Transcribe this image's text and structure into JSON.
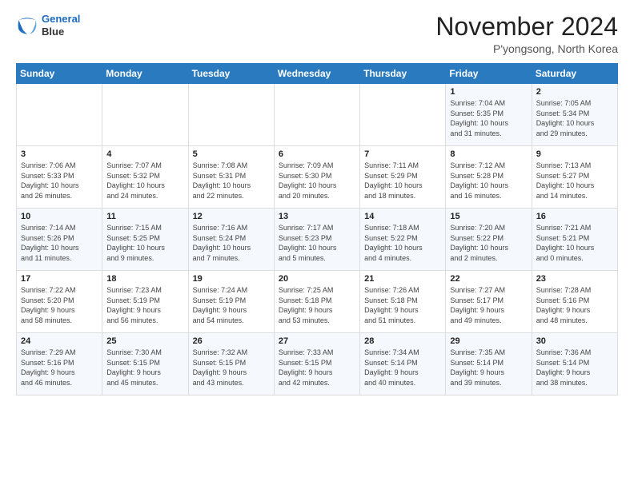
{
  "header": {
    "logo_line1": "General",
    "logo_line2": "Blue",
    "month_title": "November 2024",
    "location": "P'yongsong, North Korea"
  },
  "weekdays": [
    "Sunday",
    "Monday",
    "Tuesday",
    "Wednesday",
    "Thursday",
    "Friday",
    "Saturday"
  ],
  "weeks": [
    [
      {
        "day": "",
        "info": ""
      },
      {
        "day": "",
        "info": ""
      },
      {
        "day": "",
        "info": ""
      },
      {
        "day": "",
        "info": ""
      },
      {
        "day": "",
        "info": ""
      },
      {
        "day": "1",
        "info": "Sunrise: 7:04 AM\nSunset: 5:35 PM\nDaylight: 10 hours\nand 31 minutes."
      },
      {
        "day": "2",
        "info": "Sunrise: 7:05 AM\nSunset: 5:34 PM\nDaylight: 10 hours\nand 29 minutes."
      }
    ],
    [
      {
        "day": "3",
        "info": "Sunrise: 7:06 AM\nSunset: 5:33 PM\nDaylight: 10 hours\nand 26 minutes."
      },
      {
        "day": "4",
        "info": "Sunrise: 7:07 AM\nSunset: 5:32 PM\nDaylight: 10 hours\nand 24 minutes."
      },
      {
        "day": "5",
        "info": "Sunrise: 7:08 AM\nSunset: 5:31 PM\nDaylight: 10 hours\nand 22 minutes."
      },
      {
        "day": "6",
        "info": "Sunrise: 7:09 AM\nSunset: 5:30 PM\nDaylight: 10 hours\nand 20 minutes."
      },
      {
        "day": "7",
        "info": "Sunrise: 7:11 AM\nSunset: 5:29 PM\nDaylight: 10 hours\nand 18 minutes."
      },
      {
        "day": "8",
        "info": "Sunrise: 7:12 AM\nSunset: 5:28 PM\nDaylight: 10 hours\nand 16 minutes."
      },
      {
        "day": "9",
        "info": "Sunrise: 7:13 AM\nSunset: 5:27 PM\nDaylight: 10 hours\nand 14 minutes."
      }
    ],
    [
      {
        "day": "10",
        "info": "Sunrise: 7:14 AM\nSunset: 5:26 PM\nDaylight: 10 hours\nand 11 minutes."
      },
      {
        "day": "11",
        "info": "Sunrise: 7:15 AM\nSunset: 5:25 PM\nDaylight: 10 hours\nand 9 minutes."
      },
      {
        "day": "12",
        "info": "Sunrise: 7:16 AM\nSunset: 5:24 PM\nDaylight: 10 hours\nand 7 minutes."
      },
      {
        "day": "13",
        "info": "Sunrise: 7:17 AM\nSunset: 5:23 PM\nDaylight: 10 hours\nand 5 minutes."
      },
      {
        "day": "14",
        "info": "Sunrise: 7:18 AM\nSunset: 5:22 PM\nDaylight: 10 hours\nand 4 minutes."
      },
      {
        "day": "15",
        "info": "Sunrise: 7:20 AM\nSunset: 5:22 PM\nDaylight: 10 hours\nand 2 minutes."
      },
      {
        "day": "16",
        "info": "Sunrise: 7:21 AM\nSunset: 5:21 PM\nDaylight: 10 hours\nand 0 minutes."
      }
    ],
    [
      {
        "day": "17",
        "info": "Sunrise: 7:22 AM\nSunset: 5:20 PM\nDaylight: 9 hours\nand 58 minutes."
      },
      {
        "day": "18",
        "info": "Sunrise: 7:23 AM\nSunset: 5:19 PM\nDaylight: 9 hours\nand 56 minutes."
      },
      {
        "day": "19",
        "info": "Sunrise: 7:24 AM\nSunset: 5:19 PM\nDaylight: 9 hours\nand 54 minutes."
      },
      {
        "day": "20",
        "info": "Sunrise: 7:25 AM\nSunset: 5:18 PM\nDaylight: 9 hours\nand 53 minutes."
      },
      {
        "day": "21",
        "info": "Sunrise: 7:26 AM\nSunset: 5:18 PM\nDaylight: 9 hours\nand 51 minutes."
      },
      {
        "day": "22",
        "info": "Sunrise: 7:27 AM\nSunset: 5:17 PM\nDaylight: 9 hours\nand 49 minutes."
      },
      {
        "day": "23",
        "info": "Sunrise: 7:28 AM\nSunset: 5:16 PM\nDaylight: 9 hours\nand 48 minutes."
      }
    ],
    [
      {
        "day": "24",
        "info": "Sunrise: 7:29 AM\nSunset: 5:16 PM\nDaylight: 9 hours\nand 46 minutes."
      },
      {
        "day": "25",
        "info": "Sunrise: 7:30 AM\nSunset: 5:15 PM\nDaylight: 9 hours\nand 45 minutes."
      },
      {
        "day": "26",
        "info": "Sunrise: 7:32 AM\nSunset: 5:15 PM\nDaylight: 9 hours\nand 43 minutes."
      },
      {
        "day": "27",
        "info": "Sunrise: 7:33 AM\nSunset: 5:15 PM\nDaylight: 9 hours\nand 42 minutes."
      },
      {
        "day": "28",
        "info": "Sunrise: 7:34 AM\nSunset: 5:14 PM\nDaylight: 9 hours\nand 40 minutes."
      },
      {
        "day": "29",
        "info": "Sunrise: 7:35 AM\nSunset: 5:14 PM\nDaylight: 9 hours\nand 39 minutes."
      },
      {
        "day": "30",
        "info": "Sunrise: 7:36 AM\nSunset: 5:14 PM\nDaylight: 9 hours\nand 38 minutes."
      }
    ]
  ]
}
